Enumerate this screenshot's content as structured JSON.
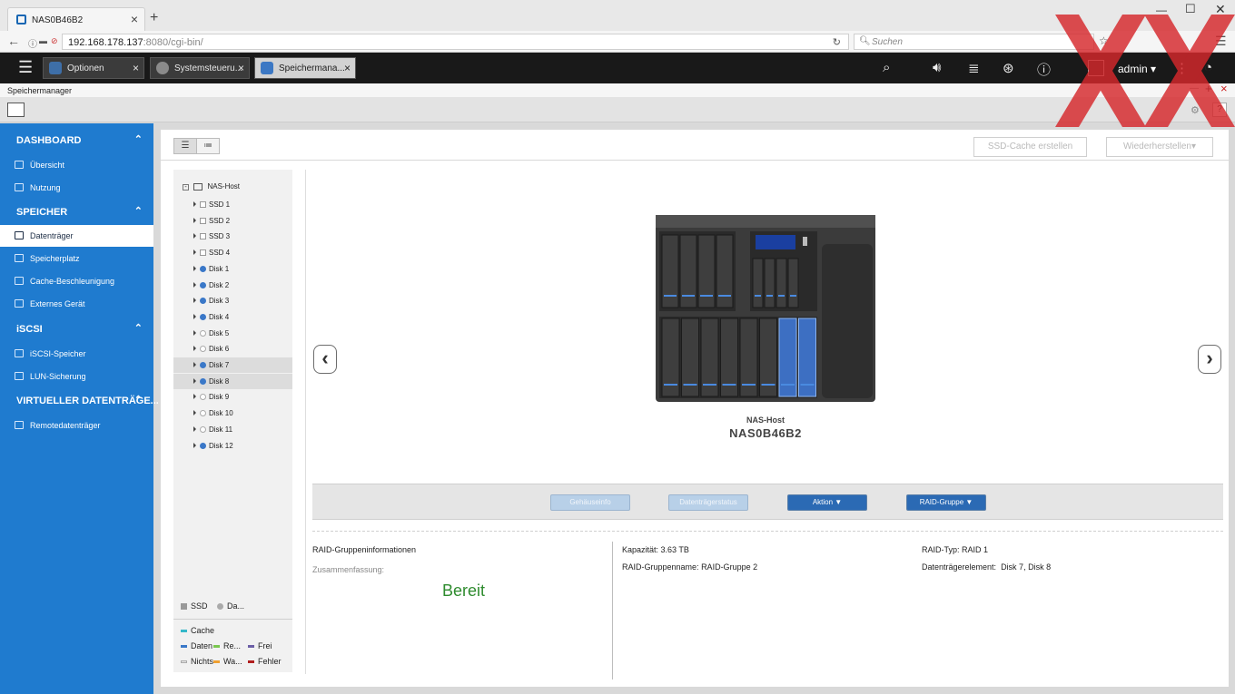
{
  "browser": {
    "tab_title": "NAS0B46B2",
    "url_host": "192.168.178.137",
    "url_rest": ":8080/cgi-bin/",
    "search_placeholder": "Suchen"
  },
  "qnap": {
    "tabs": [
      {
        "label": "Optionen"
      },
      {
        "label": "Systemsteueru..."
      },
      {
        "label": "Speichermana..."
      }
    ],
    "user": "admin"
  },
  "app": {
    "title": "Speichermanager"
  },
  "sidebar": {
    "sections": [
      {
        "label": "DASHBOARD",
        "items": [
          "Übersicht",
          "Nutzung"
        ]
      },
      {
        "label": "SPEICHER",
        "items": [
          "Datenträger",
          "Speicherplatz",
          "Cache-Beschleunigung",
          "Externes Gerät"
        ]
      },
      {
        "label": "iSCSI",
        "items": [
          "iSCSI-Speicher",
          "LUN-Sicherung"
        ]
      },
      {
        "label": "VIRTUELLER DATENTRÄGE...",
        "items": [
          "Remotedatenträger"
        ]
      }
    ],
    "selected": "Datenträger"
  },
  "toolbar": {
    "ssd_cache": "SSD-Cache erstellen",
    "restore": "Wiederherstellen"
  },
  "tree": {
    "root": "NAS-Host",
    "nodes": [
      {
        "label": "SSD 1",
        "kind": "ssd"
      },
      {
        "label": "SSD 2",
        "kind": "ssd"
      },
      {
        "label": "SSD 3",
        "kind": "ssd"
      },
      {
        "label": "SSD 4",
        "kind": "ssd"
      },
      {
        "label": "Disk 1",
        "kind": "disk-data"
      },
      {
        "label": "Disk 2",
        "kind": "disk-data"
      },
      {
        "label": "Disk 3",
        "kind": "disk-data"
      },
      {
        "label": "Disk 4",
        "kind": "disk-data"
      },
      {
        "label": "Disk 5",
        "kind": "disk-free"
      },
      {
        "label": "Disk 6",
        "kind": "disk-free"
      },
      {
        "label": "Disk 7",
        "kind": "disk-data",
        "highlighted": true
      },
      {
        "label": "Disk 8",
        "kind": "disk-data",
        "highlighted": true
      },
      {
        "label": "Disk 9",
        "kind": "disk-free"
      },
      {
        "label": "Disk 10",
        "kind": "disk-free"
      },
      {
        "label": "Disk 11",
        "kind": "disk-free"
      },
      {
        "label": "Disk 12",
        "kind": "disk-data"
      }
    ]
  },
  "legend": {
    "types": [
      "SSD",
      "Da..."
    ],
    "items": [
      {
        "label": "Cache",
        "color": "#35b8c9"
      },
      {
        "label": "Daten",
        "color": "#3a78c8"
      },
      {
        "label": "Re...",
        "color": "#7ac74f"
      },
      {
        "label": "Frei",
        "color": "#6b5fa6"
      },
      {
        "label": "Nichts",
        "color": "#e6e6e6"
      },
      {
        "label": "Wa...",
        "color": "#f0a030"
      },
      {
        "label": "Fehler",
        "color": "#b01e1e"
      }
    ]
  },
  "device": {
    "host_label": "NAS-Host",
    "name": "NAS0B46B2"
  },
  "actions": {
    "enclosure_info": "Gehäuseinfo",
    "disk_status": "Datenträgerstatus",
    "action": "Aktion ▼",
    "raid_group": "RAID-Gruppe ▼"
  },
  "info": {
    "heading": "RAID-Gruppeninformationen",
    "summary_label": "Zusammenfassung:",
    "status": "Bereit",
    "capacity_label": "Kapazität:",
    "capacity_value": "3.63 TB",
    "group_name_label": "RAID-Gruppenname:",
    "group_name_value": "RAID-Gruppe 2",
    "raid_type_label": "RAID-Typ:",
    "raid_type_value": "RAID 1",
    "members_label": "Datenträgerelement:",
    "members_value": "Disk 7, Disk 8"
  },
  "colors": {
    "sidebar": "#1f7bcf",
    "status_ok": "#2e8b2e",
    "watermark": "#d6282c"
  }
}
